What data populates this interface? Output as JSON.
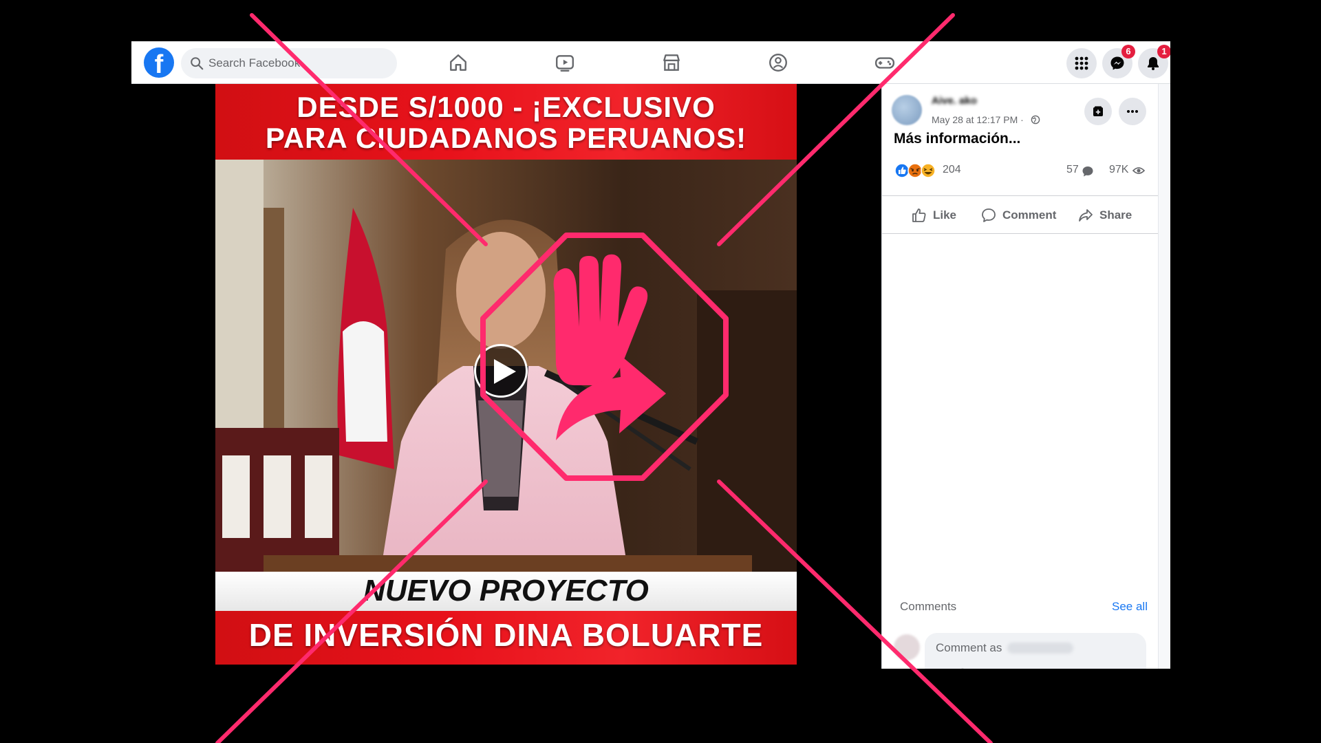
{
  "search": {
    "placeholder": "Search Facebook"
  },
  "badges": {
    "messenger": "6",
    "notifications": "1"
  },
  "video": {
    "headline_line1": "DESDE S/1000 - ¡EXCLUSIVO",
    "headline_line2": "PARA CIUDADANOS PERUANOS!",
    "middle_caption": "NUEVO PROYECTO",
    "bottom_caption": "DE INVERSIÓN DINA BOLUARTE"
  },
  "post": {
    "author_name": "Aive. ako",
    "timestamp": "May 28 at 12:17 PM ·",
    "text": "Más información...",
    "reactions_count": "204",
    "comments_count": "57",
    "views_count": "97K"
  },
  "actions": {
    "like": "Like",
    "comment": "Comment",
    "share": "Share"
  },
  "comments_section": {
    "label": "Comments",
    "see_all": "See all",
    "input_placeholder": "Comment as"
  },
  "icons": {
    "logo": "facebook-logo",
    "search": "search-icon",
    "nav": [
      "home-icon",
      "video-icon",
      "marketplace-icon",
      "groups-icon",
      "gaming-icon"
    ],
    "top_right": [
      "menu-grid-icon",
      "messenger-icon",
      "notifications-bell-icon"
    ],
    "post": [
      "globe-icon",
      "save-icon",
      "more-icon"
    ],
    "reactions": [
      "like-reaction-icon",
      "angry-reaction-icon",
      "haha-reaction-icon"
    ]
  },
  "colors": {
    "facebook_blue": "#1877f2",
    "badge_red": "#e41e3f",
    "overlay_pink": "#ff2a6d",
    "banner_red": "#e8121b"
  }
}
